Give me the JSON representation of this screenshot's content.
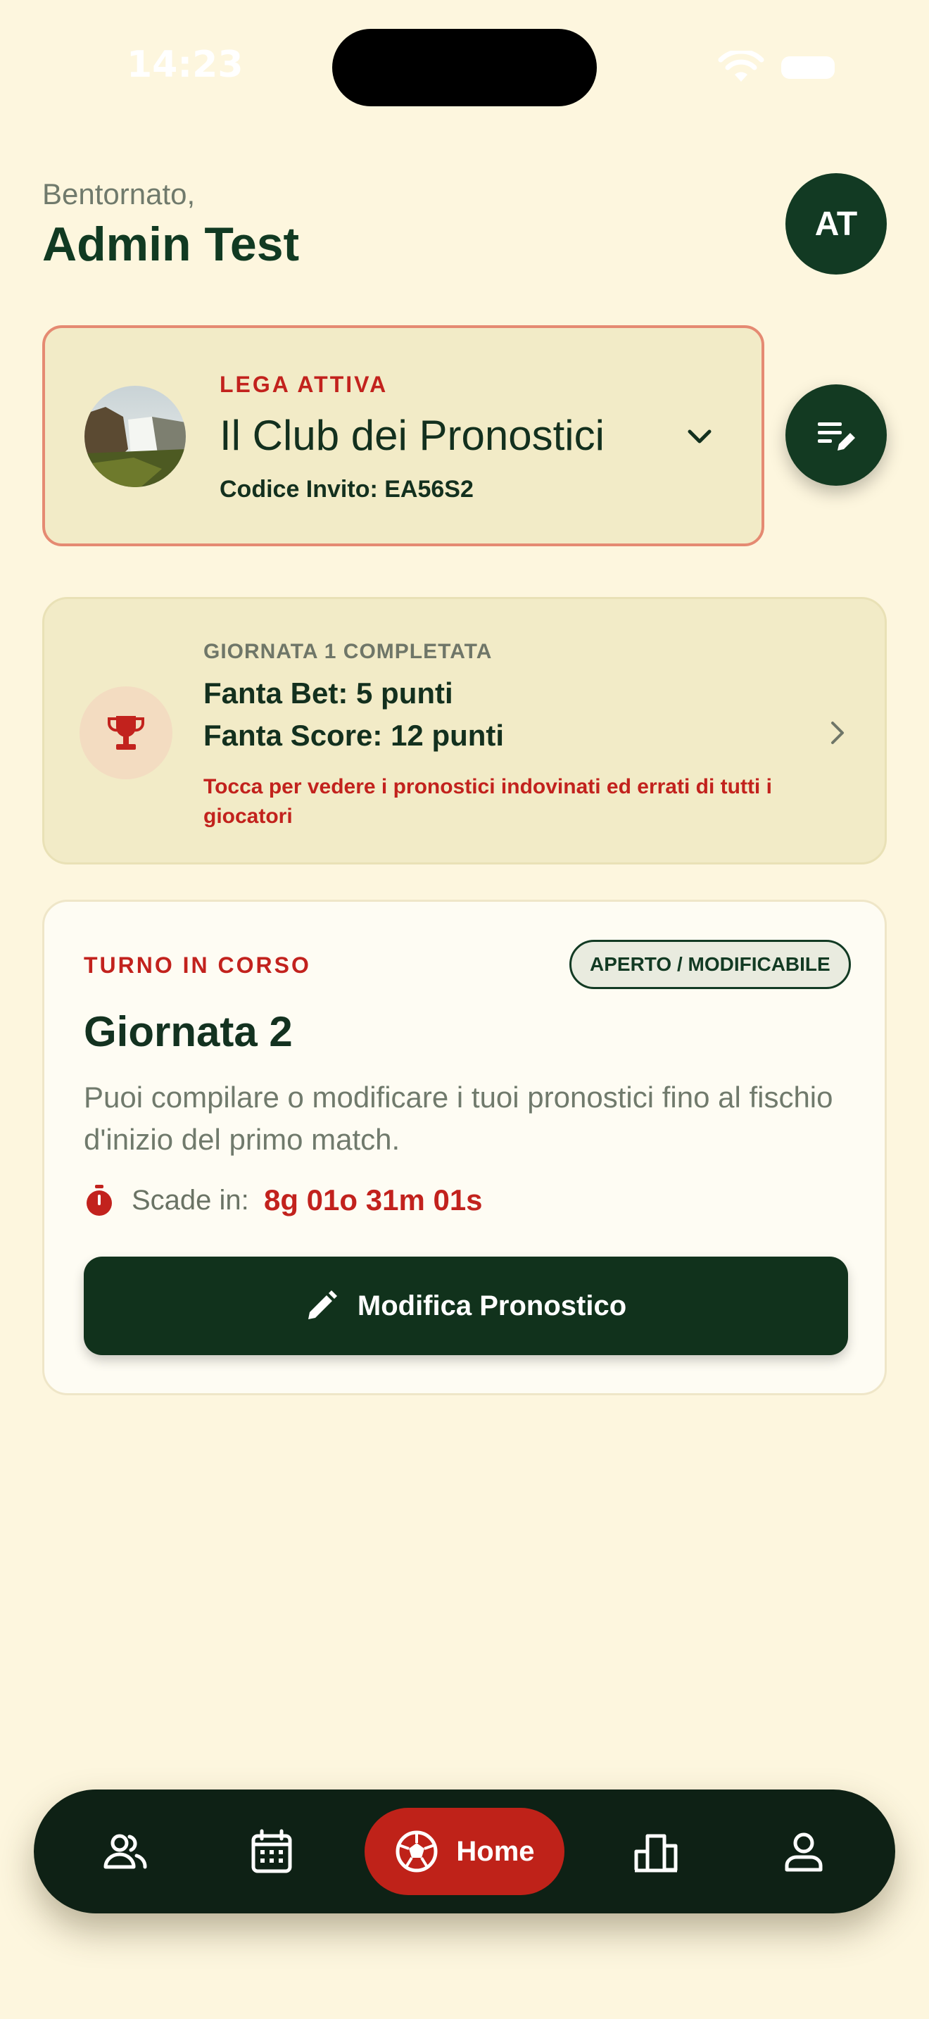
{
  "status_bar": {
    "time": "14:23"
  },
  "header": {
    "greeting": "Bentornato,",
    "user_name": "Admin Test",
    "avatar_initials": "AT"
  },
  "league": {
    "eyebrow": "LEGA ATTIVA",
    "name": "Il Club dei Pronostici",
    "invite_code": "Codice Invito: EA56S2"
  },
  "result": {
    "eyebrow": "GIORNATA 1 COMPLETATA",
    "fanta_bet": "Fanta Bet: 5 punti",
    "fanta_score": "Fanta Score: 12 punti",
    "note": "Tocca per vedere i pronostici indovinati ed errati di tutti i giocatori"
  },
  "round": {
    "eyebrow": "TURNO IN CORSO",
    "badge": "APERTO / MODIFICABILE",
    "title": "Giornata 2",
    "description": "Puoi compilare o modificare i tuoi pronostici fino al fischio d'inizio del primo match.",
    "deadline_label": "Scade in:",
    "deadline_value": "8g 01o 31m 01s",
    "button_label": "Modifica Pronostico"
  },
  "nav": {
    "items": [
      {
        "icon": "group-icon"
      },
      {
        "icon": "calendar-icon"
      },
      {
        "icon": "soccer-ball-icon",
        "label": "Home",
        "active": true
      },
      {
        "icon": "leaderboard-icon"
      },
      {
        "icon": "profile-icon"
      }
    ]
  },
  "colors": {
    "background": "#fdf6de",
    "primary_dark": "#123a23",
    "accent_red": "#c2221d",
    "card_beige": "#f2ebc7",
    "league_border": "#e58a72"
  }
}
